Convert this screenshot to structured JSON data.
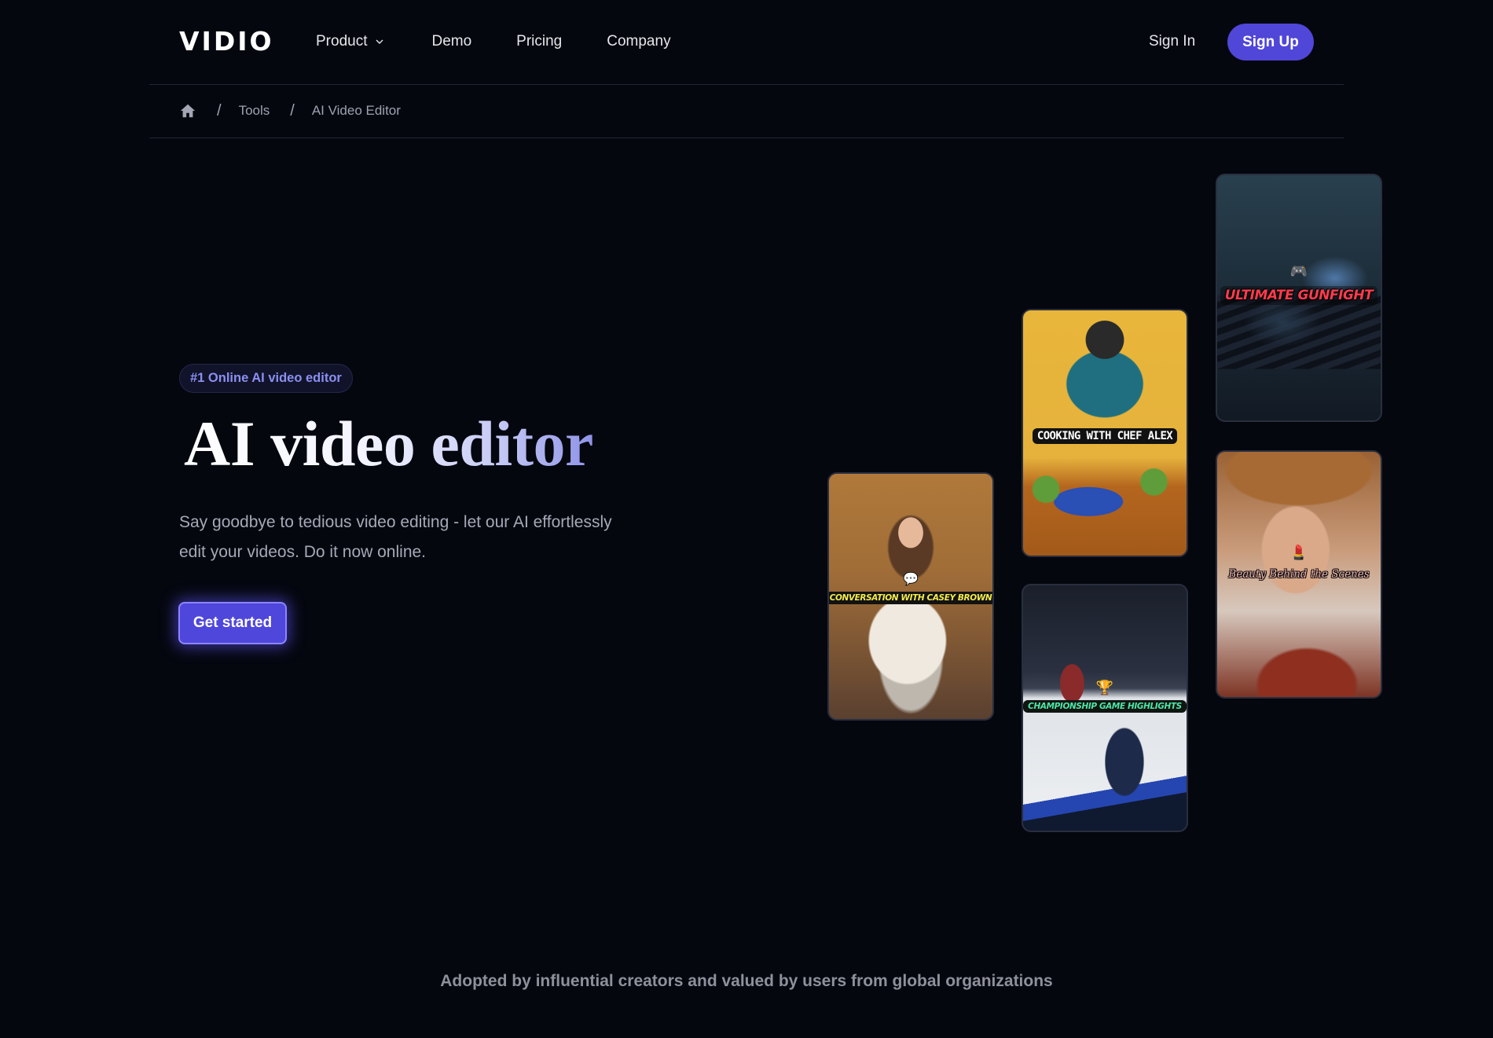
{
  "header": {
    "logo": "VIDIO",
    "nav": [
      {
        "label": "Product",
        "has_dropdown": true
      },
      {
        "label": "Demo"
      },
      {
        "label": "Pricing"
      },
      {
        "label": "Company"
      }
    ],
    "sign_in": "Sign In",
    "sign_up": "Sign Up"
  },
  "breadcrumb": {
    "home_icon": "home-icon",
    "separator": "/",
    "items": [
      "Tools",
      "AI Video Editor"
    ]
  },
  "hero": {
    "badge": "#1 Online AI video editor",
    "title": "AI video editor",
    "description": "Say goodbye to tedious video editing - let our AI effortlessly edit your videos. Do it now online.",
    "cta": "Get started"
  },
  "cards": {
    "gunfight": {
      "caption": "ULTIMATE GUNFIGHT",
      "emoji": "🎮"
    },
    "cooking": {
      "caption": "COOKING WITH CHEF ALEX",
      "emoji": ""
    },
    "casey": {
      "caption": "CONVERSATION WITH CASEY BROWN",
      "emoji": "💬"
    },
    "beauty": {
      "caption": "Beauty Behind the Scenes",
      "emoji": "💄"
    },
    "hockey": {
      "caption": "CHAMPIONSHIP GAME HIGHLIGHTS",
      "emoji": "🏆"
    }
  },
  "footer": {
    "adopted": "Adopted by influential creators and valued by users from global organizations"
  },
  "colors": {
    "background": "#05070f",
    "accent": "#5046d8",
    "badge_text": "#8b8ff0",
    "muted_text": "#9ca3af"
  }
}
